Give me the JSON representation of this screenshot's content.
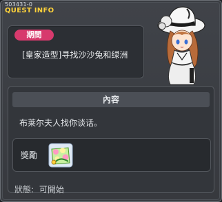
{
  "window": {
    "quest_id": "503431-0",
    "title": "QUEST INFO"
  },
  "period": {
    "badge": "期間",
    "quest_name": "[皇家造型]寻找沙沙兔和绿洲"
  },
  "content": {
    "header": "內容",
    "description": "布莱尔夫人找你谈话。"
  },
  "reward": {
    "label": "獎勵",
    "item_icon": "flower-scroll-icon"
  },
  "status": {
    "label": "狀態:",
    "value": "可開始"
  },
  "colors": {
    "title": "#ffd33a",
    "badge": "#d73a6d",
    "window_bg": "#3a3d42"
  }
}
